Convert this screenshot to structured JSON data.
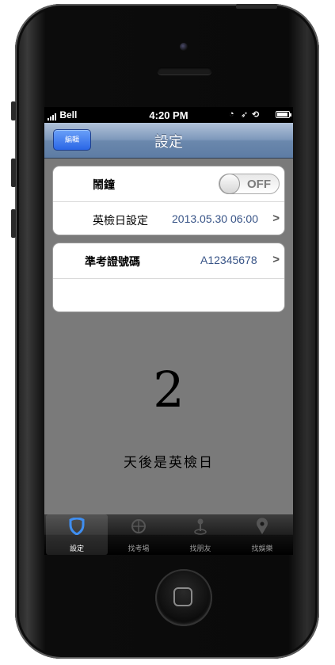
{
  "statusbar": {
    "carrier": "Bell",
    "time": "4:20 PM"
  },
  "navbar": {
    "edit_label": "編輯",
    "title": "設定"
  },
  "alarm": {
    "label": "鬧鐘",
    "toggle_label": "OFF"
  },
  "exam_date": {
    "label": "英檢日設定",
    "value": "2013.05.30 06:00"
  },
  "admission": {
    "label": "準考證號碼",
    "value": "A12345678"
  },
  "countdown": {
    "number": "2",
    "caption": "天後是英檢日"
  },
  "tabs": [
    {
      "label": "設定",
      "icon": "shield-icon",
      "selected": true
    },
    {
      "label": "找考場",
      "icon": "compass-icon",
      "selected": false
    },
    {
      "label": "找朋友",
      "icon": "map-pin-person-icon",
      "selected": false
    },
    {
      "label": "找娛樂",
      "icon": "location-pin-icon",
      "selected": false
    }
  ],
  "colors": {
    "nav_blue": "#6b88ad",
    "edit_button_blue": "#2a66e6",
    "value_blue": "#385487",
    "screen_bg": "#7a7a7a"
  }
}
